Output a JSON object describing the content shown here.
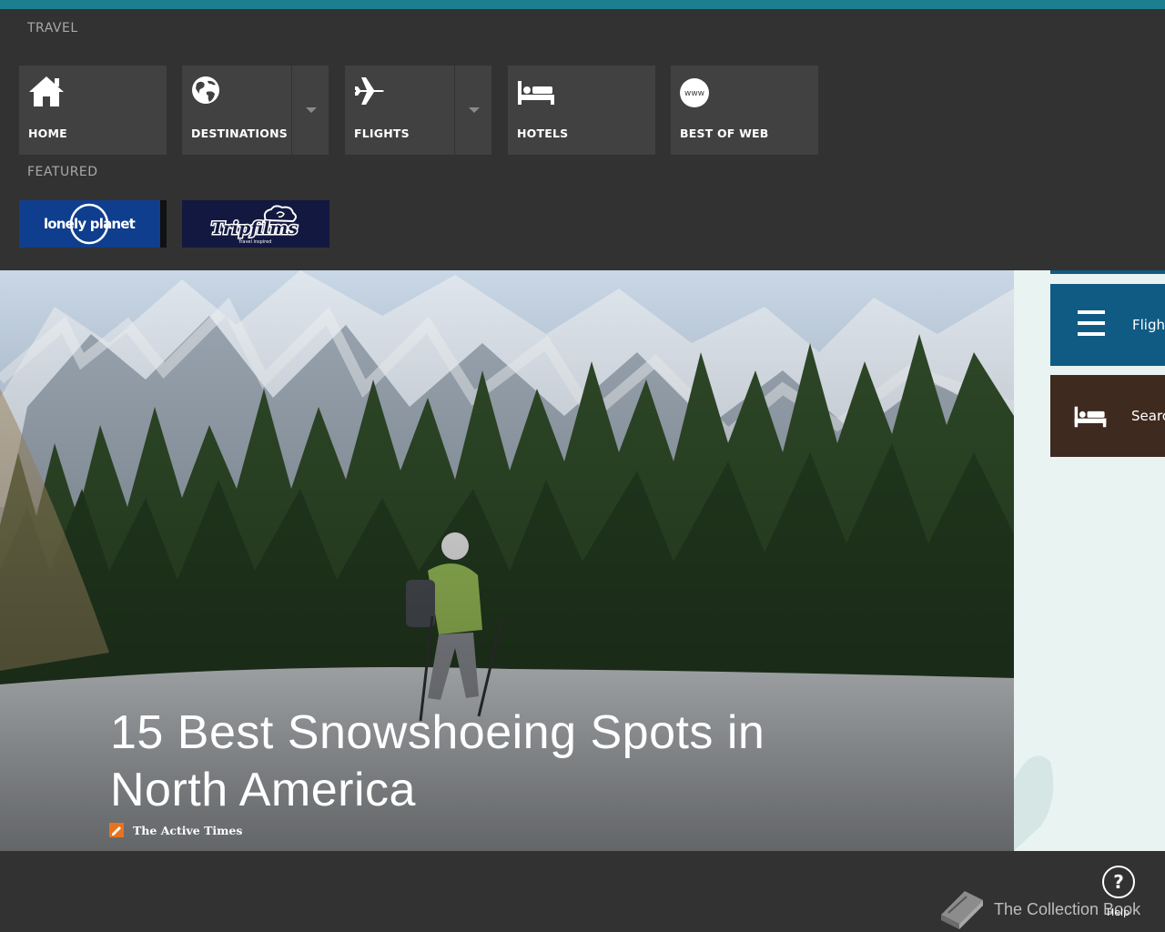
{
  "colors": {
    "accent": "#1d7e8f",
    "nav_bg": "#323232",
    "tile_bg": "#414141",
    "flights_tile": "#0f5b84",
    "hotels_tile": "#3f2a20"
  },
  "nav": {
    "section_title": "TRAVEL",
    "tiles": [
      {
        "label": "HOME",
        "icon": "home-icon"
      },
      {
        "label": "DESTINATIONS",
        "icon": "globe-icon"
      },
      {
        "label": "FLIGHTS",
        "icon": "airplane-icon"
      },
      {
        "label": "HOTELS",
        "icon": "bed-icon"
      },
      {
        "label": "BEST OF WEB",
        "icon": "www-icon",
        "icon_text": "www"
      }
    ]
  },
  "featured": {
    "section_title": "FEATURED",
    "items": [
      {
        "logo_text": "lonely planet"
      },
      {
        "logo_text": "Tripfilms",
        "tagline": "Travel inspired"
      }
    ]
  },
  "hero": {
    "title_line1": "15 Best Snowshoeing Spots in",
    "title_line2": "North America",
    "source": "The Active Times"
  },
  "right_tiles": [
    {
      "label": "Flight",
      "icon": "menu-icon"
    },
    {
      "label": "Searc",
      "icon": "bed-icon"
    }
  ],
  "appbar": {
    "collection": "The Collection Book",
    "help_symbol": "?",
    "help_label": "Help"
  }
}
